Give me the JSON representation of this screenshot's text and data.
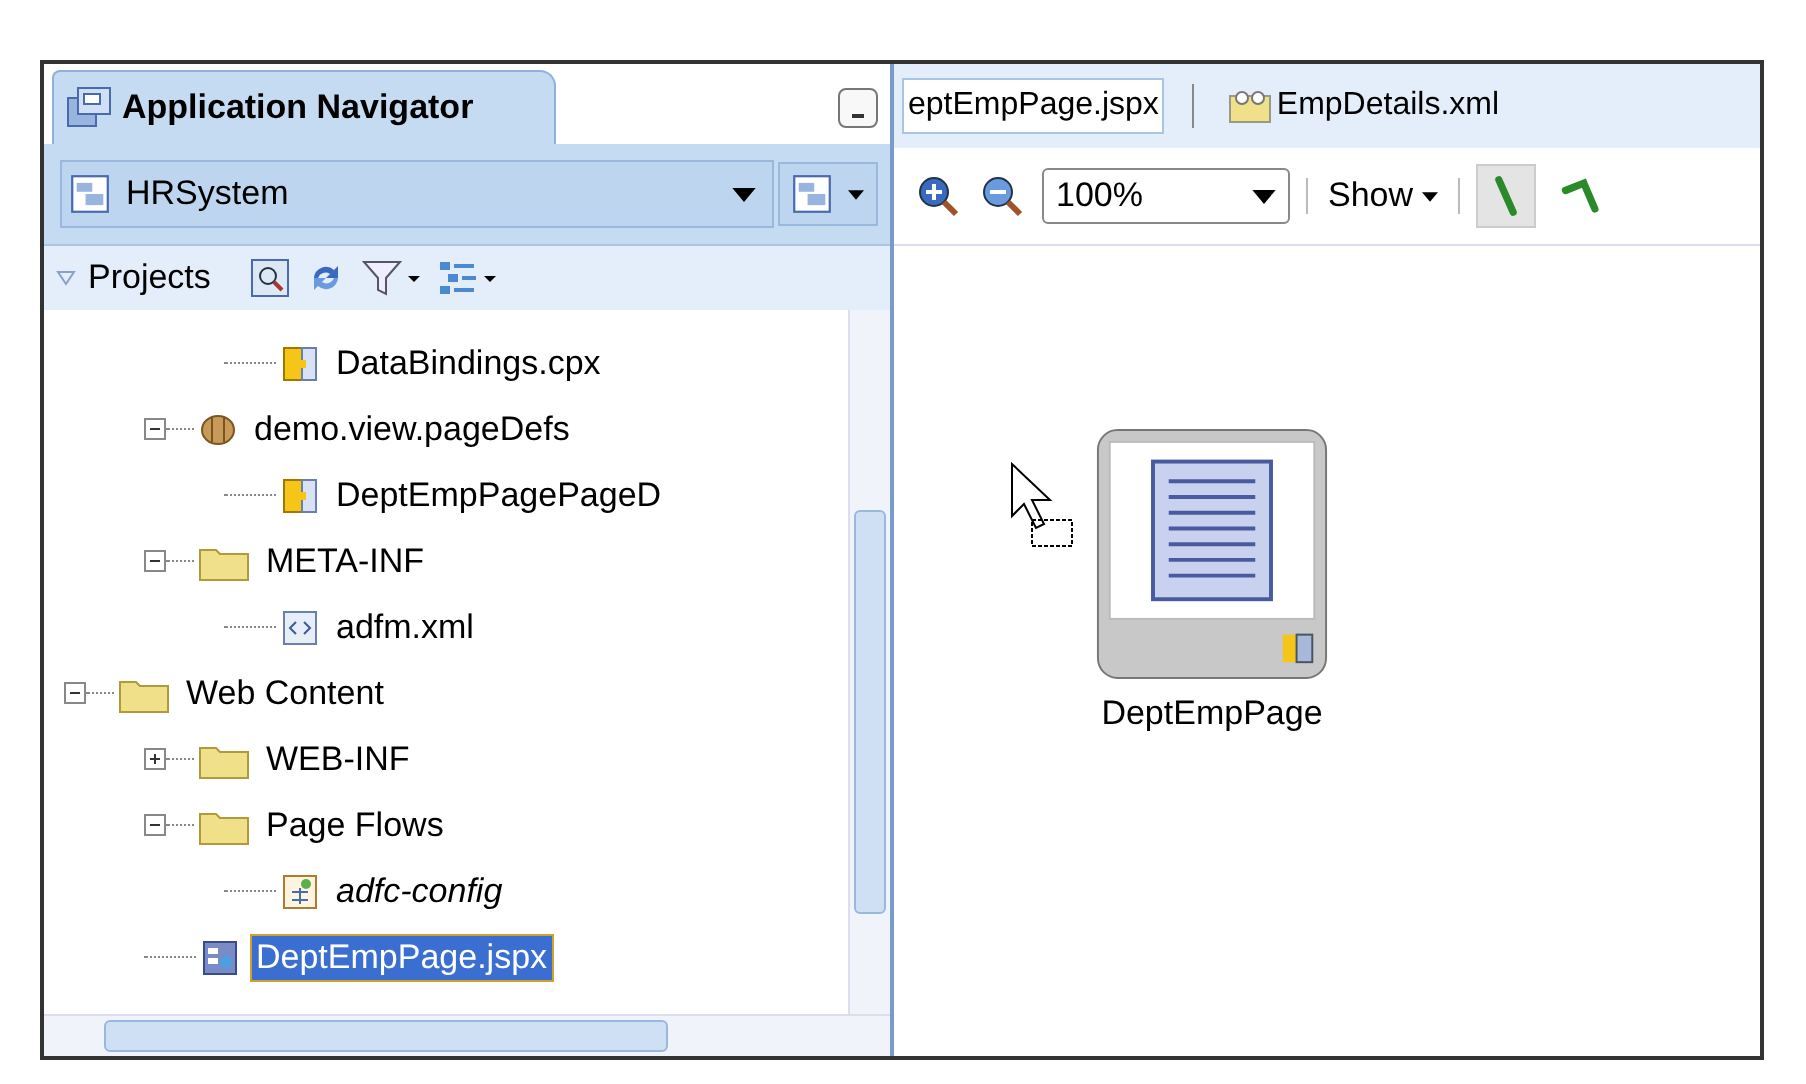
{
  "navigator": {
    "title": "Application Navigator",
    "application": "HRSystem",
    "section": {
      "label": "Projects",
      "expanded": true
    },
    "tree": [
      {
        "children": [
          {
            "children": [
              {
                "label": "DataBindings.cpx",
                "kind": "config",
                "italic": false,
                "selected": false
              }
            ]
          },
          {
            "label": "demo.view.pageDefs",
            "kind": "package",
            "expanded": true,
            "italic": false,
            "selected": false,
            "children": [
              {
                "label": "DeptEmpPagePageD",
                "kind": "config",
                "italic": false,
                "selected": false
              }
            ]
          },
          {
            "label": "META-INF",
            "kind": "folder",
            "expanded": true,
            "italic": false,
            "selected": false,
            "children": [
              {
                "label": "adfm.xml",
                "kind": "xml",
                "italic": false,
                "selected": false
              }
            ]
          }
        ]
      },
      {
        "label": "Web Content",
        "kind": "folder",
        "expanded": true,
        "italic": false,
        "selected": false,
        "children": [
          {
            "label": "WEB-INF",
            "kind": "folder",
            "expanded": false,
            "italic": false,
            "selected": false
          },
          {
            "label": "Page Flows",
            "kind": "folder",
            "expanded": true,
            "italic": false,
            "selected": false,
            "children": [
              {
                "label": "adfc-config",
                "kind": "flow",
                "italic": true,
                "selected": false
              }
            ]
          },
          {
            "label": "DeptEmpPage.jspx",
            "kind": "page",
            "italic": false,
            "selected": true
          }
        ]
      }
    ]
  },
  "editor": {
    "tabs": [
      {
        "label": "eptEmpPage.jspx",
        "kind": "plain",
        "selected": true
      },
      {
        "label": "EmpDetails.xml",
        "kind": "xml",
        "selected": false
      }
    ],
    "zoom": "100%",
    "show_menu": "Show",
    "tools": [
      {
        "kind": "line",
        "selected": true
      },
      {
        "kind": "elbow",
        "selected": false
      }
    ],
    "nodes": [
      {
        "label": "DeptEmpPage"
      }
    ]
  }
}
